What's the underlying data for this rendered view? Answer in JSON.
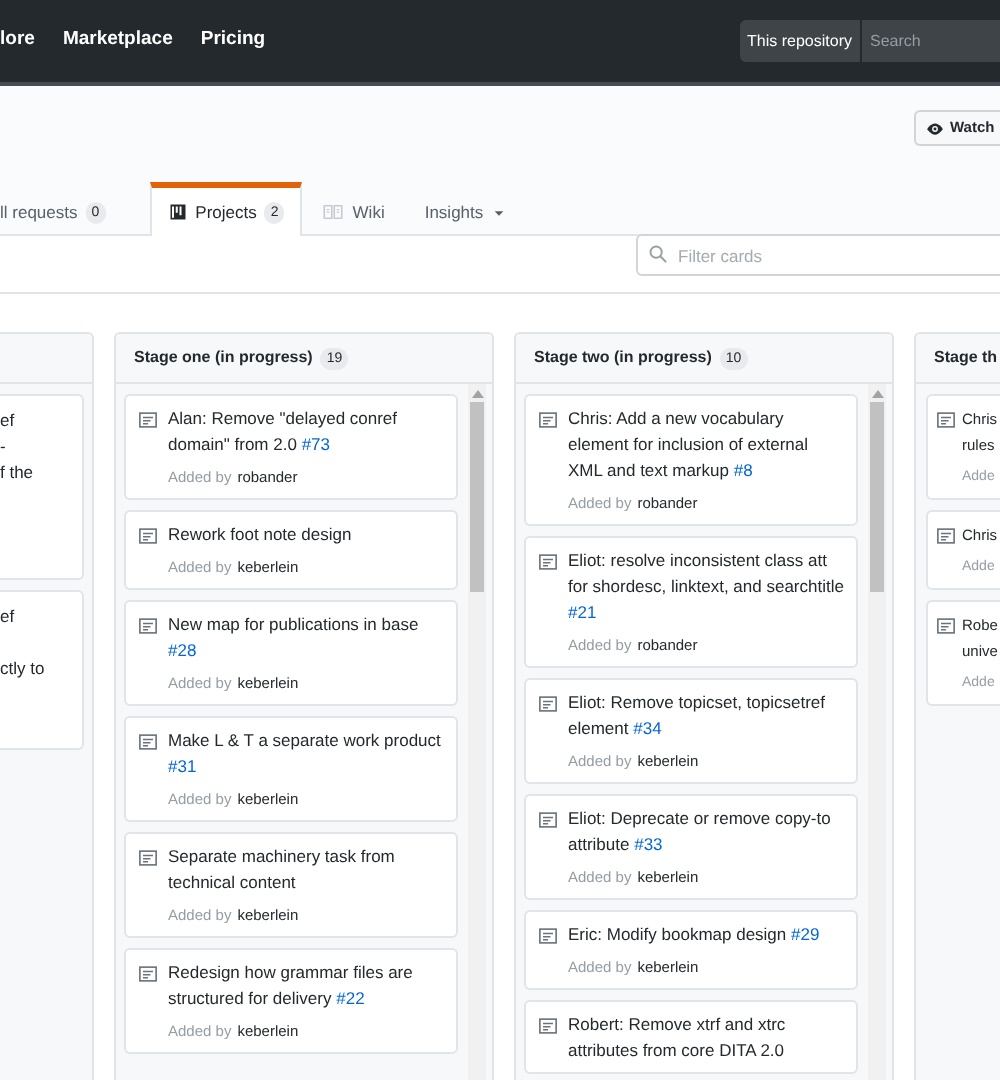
{
  "top_nav": {
    "links": [
      "lore",
      "Marketplace",
      "Pricing"
    ],
    "scope": "This repository",
    "search": {
      "placeholder": "Search"
    }
  },
  "watch_button": {
    "label": "Watch"
  },
  "tabs": [
    {
      "label": "ll requests",
      "count": "0",
      "selected": false,
      "has_menu": false
    },
    {
      "label": "Projects",
      "count": "2",
      "selected": true,
      "has_menu": false
    },
    {
      "label": "Wiki",
      "selected": false,
      "has_menu": false
    },
    {
      "label": "Insights",
      "selected": false,
      "has_menu": true
    }
  ],
  "filter": {
    "placeholder": "Filter cards"
  },
  "columns": [
    {
      "kind": "cropped",
      "cards": [
        {
          "lines": [
            "ef",
            "-",
            "f the"
          ]
        },
        {
          "lines": [
            "ef",
            "ctly to"
          ]
        }
      ]
    },
    {
      "kind": "full",
      "title": "Stage one (in progress)",
      "count": "19",
      "cards": [
        {
          "title": "Alan: Remove \"delayed conref domain\" from 2.0",
          "number": "#73",
          "added_label": "Added by",
          "author": "robander"
        },
        {
          "title": "Rework foot note design",
          "added_label": "Added by",
          "author": "keberlein"
        },
        {
          "title": "New map for publications in base",
          "number": "#28",
          "added_label": "Added by",
          "author": "keberlein"
        },
        {
          "title": "Make L & T a separate work product",
          "number": "#31",
          "added_label": "Added by",
          "author": "keberlein"
        },
        {
          "title": "Separate machinery task from technical content",
          "added_label": "Added by",
          "author": "keberlein"
        },
        {
          "title": "Redesign how grammar files are structured for delivery",
          "number": "#22",
          "added_label": "Added by",
          "author": "keberlein"
        }
      ]
    },
    {
      "kind": "full",
      "title": "Stage two (in progress)",
      "count": "10",
      "cards": [
        {
          "title": "Chris: Add a new vocabulary element for inclusion of external XML and text markup",
          "number": "#8",
          "added_label": "Added by",
          "author": "robander"
        },
        {
          "title": "Eliot: resolve inconsistent class att for shordesc, linktext, and searchtitle",
          "number": "#21",
          "added_label": "Added by",
          "author": "robander"
        },
        {
          "title": "Eliot: Remove topicset, topicsetref element",
          "number": "#34",
          "added_label": "Added by",
          "author": "keberlein"
        },
        {
          "title": "Eliot: Deprecate or remove copy-to attribute",
          "number": "#33",
          "added_label": "Added by",
          "author": "keberlein"
        },
        {
          "title": "Eric: Modify bookmap design",
          "number": "#29",
          "added_label": "Added by",
          "author": "keberlein"
        },
        {
          "title": "Robert: Remove xtrf and xtrc attributes from core DITA 2.0"
        }
      ]
    },
    {
      "kind": "edge",
      "title": "Stage th",
      "cards": [
        {
          "lines": [
            "Chris",
            "rules"
          ],
          "added": "Adde"
        },
        {
          "lines": [
            "Chris"
          ],
          "added": "Adde"
        },
        {
          "lines": [
            "Robe",
            "unive"
          ],
          "added": "Adde"
        }
      ]
    }
  ]
}
